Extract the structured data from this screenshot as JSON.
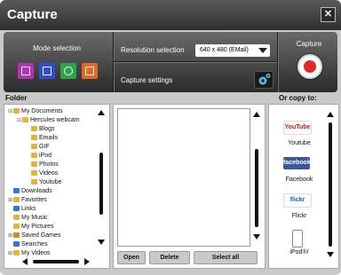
{
  "window": {
    "title": "Capture",
    "close_label": "✕"
  },
  "mode": {
    "title": "Mode selection",
    "buttons": [
      {
        "name": "photo-mode",
        "icon": "photo-frame-icon",
        "color": "#b52fb8"
      },
      {
        "name": "video-mode",
        "icon": "video-icon",
        "color": "#2d4ecf"
      },
      {
        "name": "timelapse-mode",
        "icon": "timer-icon",
        "color": "#2fa34a"
      },
      {
        "name": "burst-mode",
        "icon": "burst-icon",
        "color": "#e06a1f"
      }
    ]
  },
  "resolution": {
    "label": "Resolution selection",
    "value": "640 x 480 (EMail)"
  },
  "capture_settings": {
    "label": "Capture settings"
  },
  "capture": {
    "label": "Capture",
    "button_color": "#e32626"
  },
  "folder": {
    "title": "Folder",
    "items": [
      {
        "label": "My Documents",
        "expander": "⊟",
        "color": "#e3b33e"
      },
      {
        "label": "Hercules webcam",
        "expander": "⊟",
        "color": "#e3b33e"
      },
      {
        "label": "Blogs",
        "expander": "",
        "color": "#e3b33e"
      },
      {
        "label": "Emails",
        "expander": "",
        "color": "#e3b33e"
      },
      {
        "label": "GIF",
        "expander": "",
        "color": "#e3b33e"
      },
      {
        "label": "iPod",
        "expander": "",
        "color": "#e3b33e"
      },
      {
        "label": "Photos",
        "expander": "",
        "color": "#e3b33e"
      },
      {
        "label": "Videos",
        "expander": "",
        "color": "#e3b33e"
      },
      {
        "label": "Youtube",
        "expander": "",
        "color": "#e3b33e"
      },
      {
        "label": "Downloads",
        "expander": "",
        "color": "#2f7ad6"
      },
      {
        "label": "Favorites",
        "expander": "⊞",
        "color": "#e3b33e"
      },
      {
        "label": "Links",
        "expander": "",
        "color": "#2f7ad6"
      },
      {
        "label": "My Music",
        "expander": "",
        "color": "#e3b33e"
      },
      {
        "label": "My Pictures",
        "expander": "",
        "color": "#e3b33e"
      },
      {
        "label": "Saved Games",
        "expander": "⊞",
        "color": "#d08a2a"
      },
      {
        "label": "Searches",
        "expander": "",
        "color": "#2f7ad6"
      },
      {
        "label": "My Videos",
        "expander": "⊞",
        "color": "#e3b33e"
      }
    ]
  },
  "files": {
    "open_label": "Open",
    "delete_label": "Delete",
    "select_all_label": "Select all"
  },
  "copy": {
    "title": "Or copy to:",
    "items": [
      {
        "logo": "YouTube",
        "label": "Youtube",
        "bg": "#ffffff",
        "fg": "#c8161e"
      },
      {
        "logo": "facebook",
        "label": "Facebook",
        "bg": "#3b5998",
        "fg": "#ffffff"
      },
      {
        "logo": "flickr",
        "label": "Flickr",
        "bg": "#ffffff",
        "fg": "#0063dc"
      },
      {
        "logo": "",
        "label": "iPod®/",
        "bg": "#ffffff",
        "fg": "#222222"
      }
    ]
  }
}
